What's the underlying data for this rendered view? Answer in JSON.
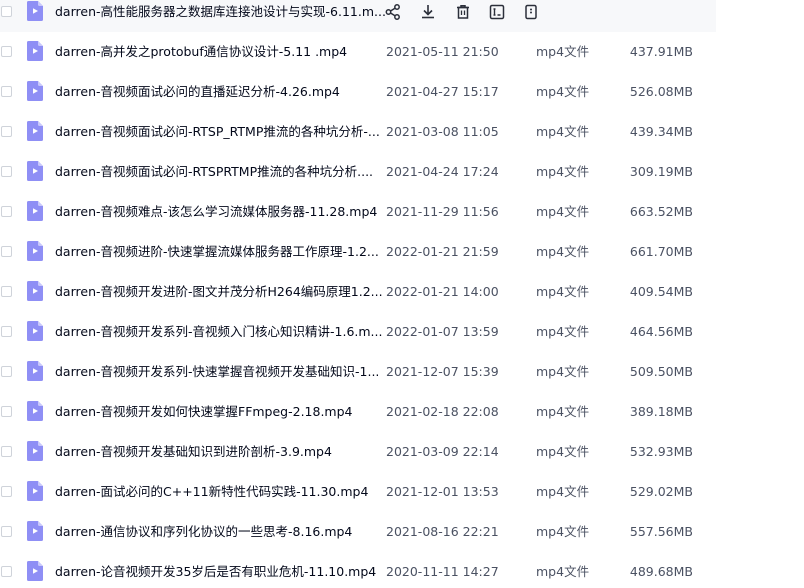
{
  "colors": {
    "icon_fill": "#8f8ff5",
    "icon_fold": "#c9c9fb",
    "icon_play": "#ffffff",
    "action_icon": "#2b2f3a",
    "row_hover": "#f7f8fa"
  },
  "hovered_row_actions": [
    {
      "name": "share-icon"
    },
    {
      "name": "download-icon"
    },
    {
      "name": "delete-icon"
    },
    {
      "name": "rename-icon"
    },
    {
      "name": "more-icon"
    }
  ],
  "files": [
    {
      "name": "darren-高性能服务器之数据库连接池设计与实现-6.11.m...",
      "date": "",
      "type": "",
      "size": ""
    },
    {
      "name": "darren-高并发之protobuf通信协议设计-5.11 .mp4",
      "date": "2021-05-11 21:50",
      "type": "mp4文件",
      "size": "437.91MB"
    },
    {
      "name": "darren-音视频面试必问的直播延迟分析-4.26.mp4",
      "date": "2021-04-27 15:17",
      "type": "mp4文件",
      "size": "526.08MB"
    },
    {
      "name": "darren-音视频面试必问-RTSP_RTMP推流的各种坑分析-...",
      "date": "2021-03-08 11:05",
      "type": "mp4文件",
      "size": "439.34MB"
    },
    {
      "name": "darren-音视频面试必问-RTSPRTMP推流的各种坑分析....",
      "date": "2021-04-24 17:24",
      "type": "mp4文件",
      "size": "309.19MB"
    },
    {
      "name": "darren-音视频难点-该怎么学习流媒体服务器-11.28.mp4",
      "date": "2021-11-29 11:56",
      "type": "mp4文件",
      "size": "663.52MB"
    },
    {
      "name": "darren-音视频进阶-快速掌握流媒体服务器工作原理-1.2...",
      "date": "2022-01-21 21:59",
      "type": "mp4文件",
      "size": "661.70MB"
    },
    {
      "name": "darren-音视频开发进阶-图文并茂分析H264编码原理1.2...",
      "date": "2022-01-21 14:00",
      "type": "mp4文件",
      "size": "409.54MB"
    },
    {
      "name": "darren-音视频开发系列-音视频入门核心知识精讲-1.6.m...",
      "date": "2022-01-07 13:59",
      "type": "mp4文件",
      "size": "464.56MB"
    },
    {
      "name": "darren-音视频开发系列-快速掌握音视频开发基础知识-1...",
      "date": "2021-12-07 15:39",
      "type": "mp4文件",
      "size": "509.50MB"
    },
    {
      "name": "darren-音视频开发如何快速掌握FFmpeg-2.18.mp4",
      "date": "2021-02-18 22:08",
      "type": "mp4文件",
      "size": "389.18MB"
    },
    {
      "name": "darren-音视频开发基础知识到进阶剖析-3.9.mp4",
      "date": "2021-03-09 22:14",
      "type": "mp4文件",
      "size": "532.93MB"
    },
    {
      "name": "darren-面试必问的C++11新特性代码实践-11.30.mp4",
      "date": "2021-12-01 13:53",
      "type": "mp4文件",
      "size": "529.02MB"
    },
    {
      "name": "darren-通信协议和序列化协议的一些思考-8.16.mp4",
      "date": "2021-08-16 22:21",
      "type": "mp4文件",
      "size": "557.56MB"
    },
    {
      "name": "darren-论音视频开发35岁后是否有职业危机-11.10.mp4",
      "date": "2020-11-11 14:27",
      "type": "mp4文件",
      "size": "489.68MB"
    }
  ]
}
